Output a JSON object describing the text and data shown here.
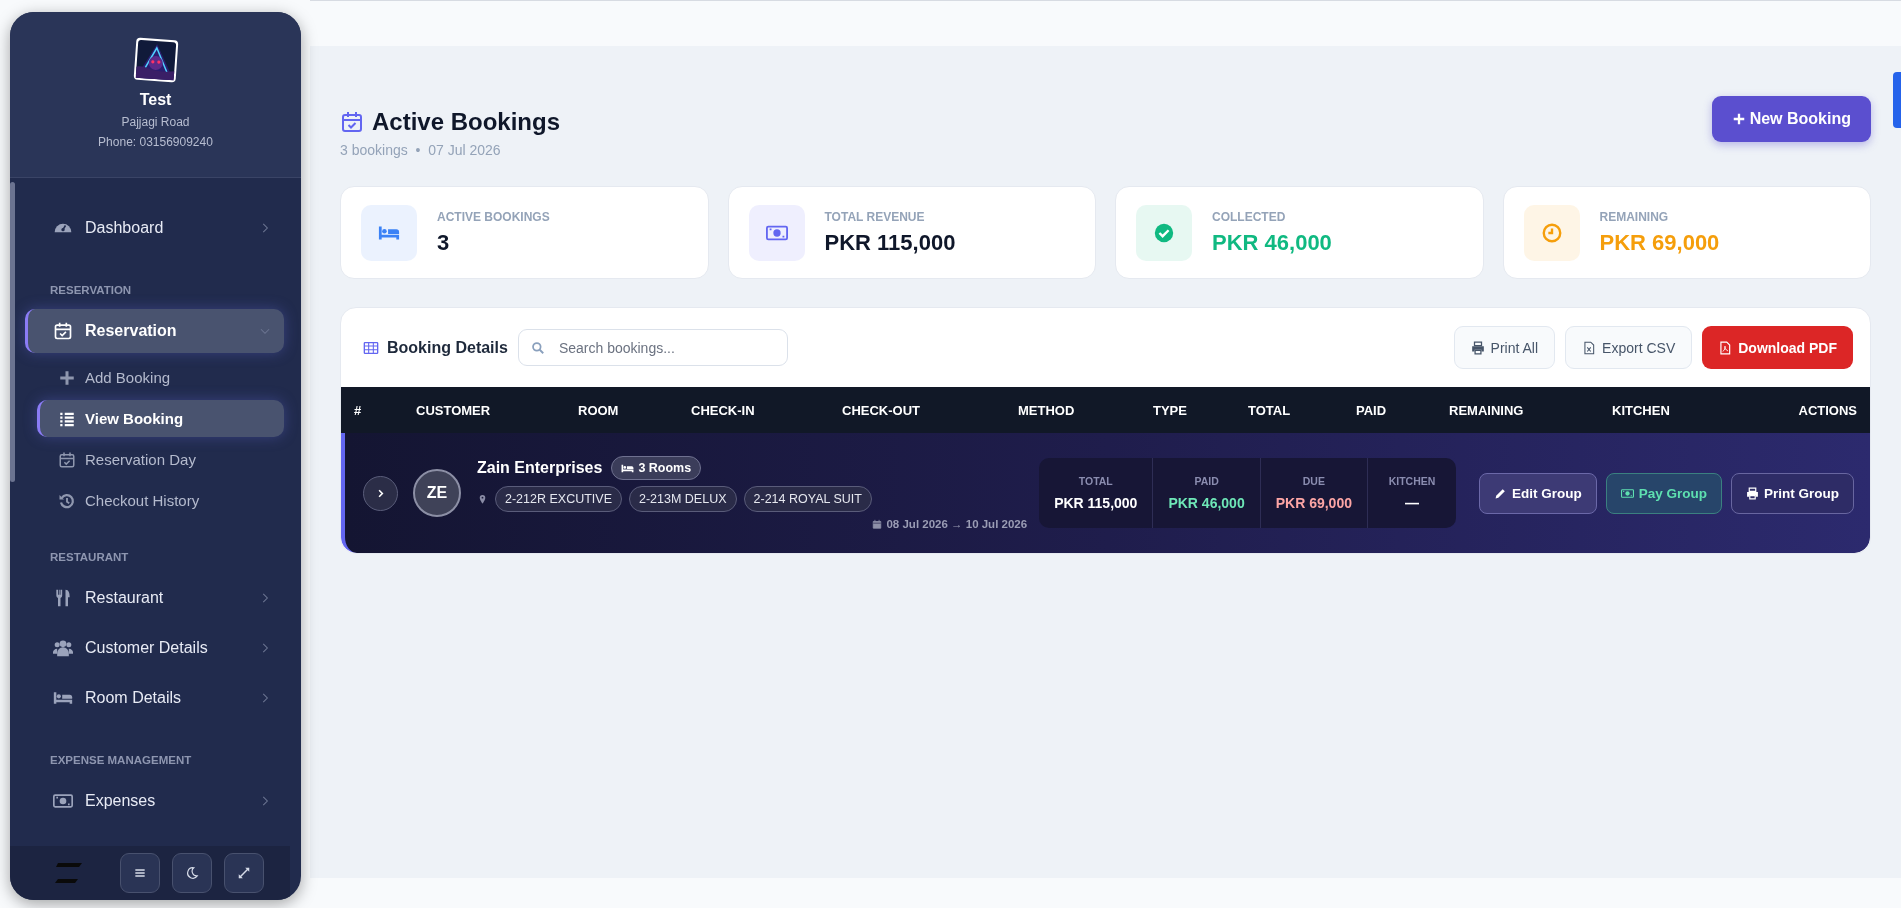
{
  "sidebar": {
    "profile": {
      "name": "Test",
      "address": "Pajjagi Road",
      "phone": "Phone: 03156909240"
    },
    "nav": [
      {
        "kind": "link",
        "label": "Dashboard",
        "selected": false,
        "expanded": false
      },
      {
        "kind": "heading",
        "label": "RESERVATION"
      },
      {
        "kind": "group",
        "label": "Reservation",
        "selected": true,
        "expanded": true,
        "children": [
          {
            "label": "Add Booking",
            "selected": false
          },
          {
            "label": "View Booking",
            "selected": true
          },
          {
            "label": "Reservation Day",
            "selected": false
          },
          {
            "label": "Checkout History",
            "selected": false
          }
        ]
      },
      {
        "kind": "heading",
        "label": "RESTAURANT"
      },
      {
        "kind": "link",
        "label": "Restaurant",
        "selected": false,
        "expanded": false
      },
      {
        "kind": "link",
        "label": "Customer Details",
        "selected": false,
        "expanded": false
      },
      {
        "kind": "link",
        "label": "Room Details",
        "selected": false,
        "expanded": false
      },
      {
        "kind": "heading",
        "label": "EXPENSE MANAGEMENT"
      },
      {
        "kind": "link",
        "label": "Expenses",
        "selected": false,
        "expanded": false
      }
    ]
  },
  "header": {
    "title": "Active Bookings",
    "subtitle": "3 bookings  •  07 Jul 2026",
    "new_button": "New Booking"
  },
  "stats": [
    {
      "kind": "count",
      "label": "ACTIVE BOOKINGS",
      "value": "3",
      "color": "#3b82f6"
    },
    {
      "kind": "revenue",
      "label": "TOTAL REVENUE",
      "value": "PKR 115,000",
      "color": "#6366f1"
    },
    {
      "kind": "collected",
      "label": "COLLECTED",
      "value": "PKR 46,000",
      "color": "#10b981"
    },
    {
      "kind": "remaining",
      "label": "REMAINING",
      "value": "PKR 69,000",
      "color": "#f59e0b"
    }
  ],
  "table": {
    "title": "Booking Details",
    "search": {
      "placeholder": "Search bookings..."
    },
    "buttons": [
      {
        "kind": "print",
        "label": "Print All"
      },
      {
        "kind": "export",
        "label": "Export CSV"
      },
      {
        "kind": "pdf",
        "label": "Download PDF"
      }
    ],
    "columns": [
      "#",
      "CUSTOMER",
      "ROOM",
      "CHECK-IN",
      "CHECK-OUT",
      "METHOD",
      "TYPE",
      "TOTAL",
      "PAID",
      "REMAINING",
      "KITCHEN",
      "ACTIONS"
    ],
    "rows": [
      {
        "expanded": false,
        "initials": "ZE",
        "customer": "Zain Enterprises",
        "rooms_badge": "3 Rooms",
        "rooms": [
          "2-212R EXCUTIVE",
          "2-213M DELUX",
          "2-214 ROYAL SUIT"
        ],
        "dates": "08 Jul 2026 → 10 Jul 2026",
        "summary": [
          {
            "kind": "total",
            "label": "TOTAL",
            "value": "PKR 115,000"
          },
          {
            "kind": "paid",
            "label": "PAID",
            "value": "PKR 46,000"
          },
          {
            "kind": "due",
            "label": "DUE",
            "value": "PKR 69,000"
          },
          {
            "kind": "kitchen",
            "label": "KITCHEN",
            "value": "—"
          }
        ],
        "actions": [
          {
            "kind": "edit",
            "label": "Edit Group"
          },
          {
            "kind": "pay",
            "label": "Pay Group"
          },
          {
            "kind": "print",
            "label": "Print Group"
          }
        ]
      }
    ]
  }
}
